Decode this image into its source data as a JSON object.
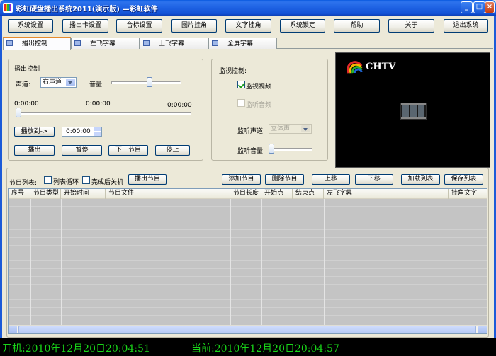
{
  "window": {
    "title": "彩虹硬盘播出系统2011(演示版) —彩虹软件"
  },
  "toolbar": {
    "system_settings": "系统设置",
    "card_settings": "播出卡设置",
    "logo_settings": "台标设置",
    "picture_overlay": "图片挂角",
    "text_overlay": "文字挂角",
    "system_lock": "系统锁定",
    "help": "帮助",
    "about": "关于",
    "exit": "退出系统"
  },
  "tabs": [
    "播出控制",
    "左飞字幕",
    "上飞字幕",
    "全屏字幕"
  ],
  "playback": {
    "group_title": "播出控制",
    "channel_label": "声道:",
    "channel_value": "右声道",
    "volume_label": "音量:",
    "time_start": "0:00:00",
    "time_mid": "0:00:00",
    "time_end": "0:00:00",
    "seek_button": "播放到->",
    "seek_time": "0:00:00",
    "play": "播出",
    "pause": "暂停",
    "next": "下一节目",
    "stop": "停止"
  },
  "monitor": {
    "group_title": "监视控制:",
    "monitor_video": "监视视频",
    "monitor_video_checked": true,
    "monitor_audio": "监听音频",
    "monitor_audio_checked": false,
    "channel_label": "监听声道:",
    "channel_value": "立体声",
    "volume_label": "监听音量:"
  },
  "preview": {
    "logo_text": "CHTV"
  },
  "program": {
    "list_label": "节目列表:",
    "loop_label": "列表循环",
    "shutdown_label": "完成后关机",
    "playout_button": "播出节目",
    "add": "添加节目",
    "delete": "删除节目",
    "up": "上移",
    "down": "下移",
    "load": "加载列表",
    "save": "保存列表",
    "columns": [
      "序号",
      "节目类型",
      "开始时间",
      "节目文件",
      "节目长度",
      "开始点",
      "结束点",
      "左飞字幕",
      "挂角文字"
    ]
  },
  "status": {
    "boot_time": "开机:2010年12月20日20:04:51",
    "current_time": "当前:2010年12月20日20:04:57"
  },
  "colors": {
    "titlebar": "#1e62e3",
    "status_text": "#19d419",
    "accent_tab": "#e68b2c"
  }
}
